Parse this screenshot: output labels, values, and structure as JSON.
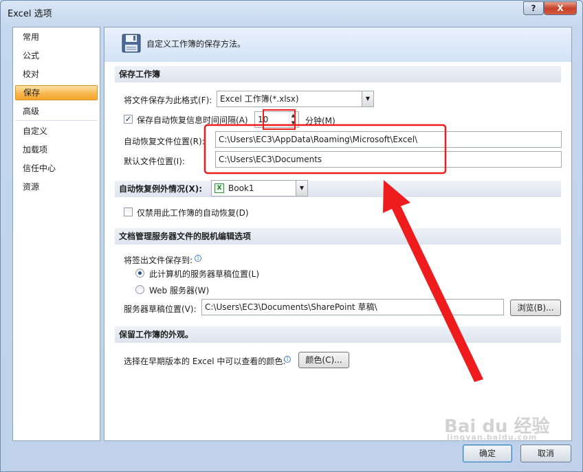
{
  "window": {
    "title": "Excel 选项",
    "help_label": "?",
    "close_label": "X"
  },
  "nav": {
    "items": [
      {
        "label": "常用"
      },
      {
        "label": "公式"
      },
      {
        "label": "校对"
      },
      {
        "label": "保存",
        "active": true
      },
      {
        "label": "高级"
      },
      {
        "label": "自定义"
      },
      {
        "label": "加载项"
      },
      {
        "label": "信任中心"
      },
      {
        "label": "资源"
      }
    ]
  },
  "header": {
    "icon": "floppy-disk-icon",
    "text": "自定义工作簿的保存方法。"
  },
  "save_workbooks": {
    "section_title": "保存工作簿",
    "format_label": "将文件保存为此格式(F):",
    "format_value": "Excel 工作簿(*.xlsx)",
    "autorecover_checked": true,
    "autorecover_label": "保存自动恢复信息时间间隔(A)",
    "interval_value": "10",
    "minutes_label": "分钟(M)",
    "autorecover_location_label": "自动恢复文件位置(R):",
    "autorecover_location_value": "C:\\Users\\EC3\\AppData\\Roaming\\Microsoft\\Excel\\",
    "default_location_label": "默认文件位置(I):",
    "default_location_value": "C:\\Users\\EC3\\Documents"
  },
  "autorecover_exceptions": {
    "section_title": "自动恢复例外情况(X):",
    "workbook_value": "Book1",
    "workbook_icon": "excel-file-icon",
    "disable_checked": false,
    "disable_label": "仅禁用此工作簿的自动恢复(D)"
  },
  "offline_editing": {
    "section_title": "文档管理服务器文件的脱机编辑选项",
    "checkout_label": "将签出文件保存到:",
    "option_local": "此计算机的服务器草稿位置(L)",
    "option_web": "Web 服务器(W)",
    "selected": "local",
    "drafts_label": "服务器草稿位置(V):",
    "drafts_value": "C:\\Users\\EC3\\Documents\\SharePoint 草稿\\",
    "browse_label": "浏览(B)..."
  },
  "visual_appearance": {
    "section_title": "保留工作簿的外观。",
    "colors_label": "选择在早期版本的 Excel 中可以查看的颜色:",
    "colors_button": "颜色(C)..."
  },
  "footer": {
    "ok_label": "确定",
    "cancel_label": "取消"
  },
  "watermark": {
    "main": "Bai du 经验",
    "sub": "jingyan.baidu.com"
  },
  "annotation_color": "#ee1c1c"
}
